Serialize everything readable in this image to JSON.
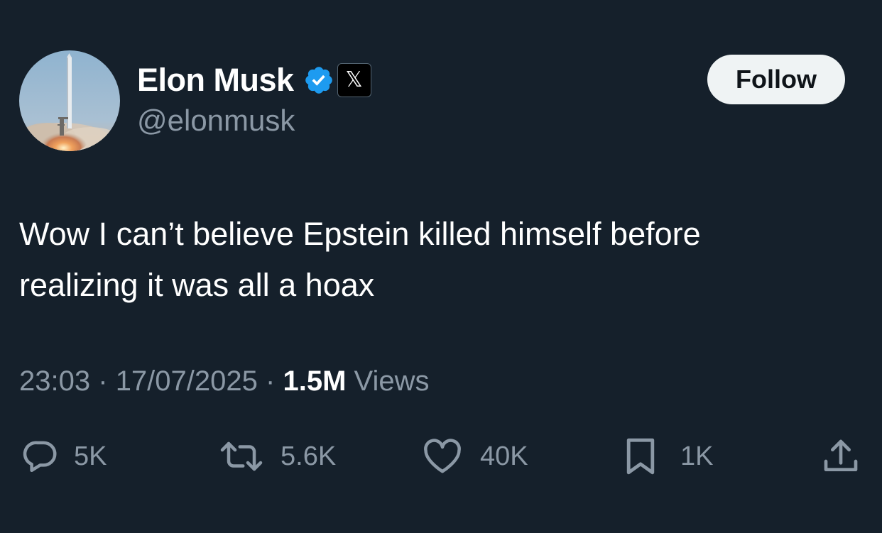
{
  "author": {
    "display_name": "Elon Musk",
    "handle": "@elonmusk",
    "verified": true,
    "verified_color": "#1d9bf0",
    "affiliation_badge_icon": "x-logo-icon",
    "affiliation_badge_glyph": "𝕏",
    "avatar": "rocket-launch-avatar"
  },
  "follow_button": {
    "label": "Follow"
  },
  "tweet": {
    "lines": [
      "Wow I can’t believe Epstein killed himself before",
      "realizing it was all a hoax"
    ]
  },
  "meta": {
    "time": "23:03",
    "separator": "·",
    "date": "17/07/2025",
    "views_count": "1.5M",
    "views_label": "Views"
  },
  "actions": {
    "replies": {
      "icon": "reply-icon",
      "count": "5K"
    },
    "reposts": {
      "icon": "repost-icon",
      "count": "5.6K"
    },
    "likes": {
      "icon": "heart-icon",
      "count": "40K"
    },
    "bookmarks": {
      "icon": "bookmark-icon",
      "count": "1K"
    },
    "share": {
      "icon": "share-icon"
    }
  },
  "colors": {
    "background": "#15202b",
    "primary_text": "#ffffff",
    "secondary_text": "#8b98a5",
    "follow_bg": "#eff3f4",
    "follow_text": "#0f1419"
  }
}
